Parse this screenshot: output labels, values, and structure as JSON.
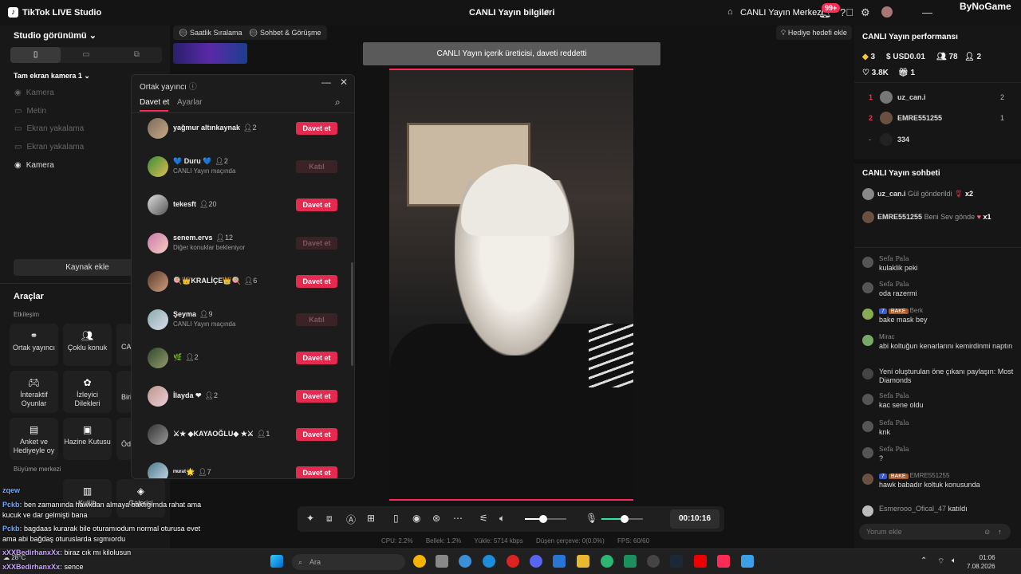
{
  "titlebar": {
    "app_title": "TikTok LIVE Studio",
    "center_title": "CANLI Yayın bilgileri",
    "live_center": "CANLI Yayın Merkezi",
    "notif_badge": "99+",
    "brand": "ByNoGame"
  },
  "left": {
    "studio_view": "Studio görünümü",
    "camera_scene": "Tam ekran kamera 1",
    "sources": [
      "Kamera",
      "Metin",
      "Ekran yakalama",
      "Ekran yakalama",
      "Kamera"
    ],
    "add_source": "Kaynak ekle",
    "tools_title": "Araçlar",
    "engagement": "Etkileşim",
    "tools": [
      {
        "label": "Ortak yayıncı",
        "icon": "link-icon"
      },
      {
        "label": "Çoklu konuk",
        "icon": "users-icon"
      },
      {
        "label": "CA",
        "icon": "more-icon"
      },
      {
        "label": "İnteraktif Oyunlar",
        "icon": "gamepad-icon"
      },
      {
        "label": "İzleyici Dilekleri",
        "icon": "gift-icon"
      },
      {
        "label": "Biri",
        "icon": "more-icon"
      },
      {
        "label": "Anket ve Hediyeyle oy",
        "icon": "poll-icon"
      },
      {
        "label": "Hazine Kutusu",
        "icon": "treasure-icon"
      },
      {
        "label": "Öd",
        "icon": "more-icon"
      }
    ],
    "growth": "Büyüme merkezi",
    "growth_tools": [
      "Kulüb",
      "Galerisi"
    ]
  },
  "chips": [
    "Saatlik Sıralama",
    "Sohbet & Görüşme"
  ],
  "gift_goal": "Hediye hedefi ekle",
  "toast": "CANLI Yayın içerik üreticisi, daveti reddetti",
  "dialog": {
    "title": "Ortak yayıncı",
    "tabs": [
      "Davet et",
      "Ayarlar"
    ],
    "rows": [
      {
        "name": "yağmur altınkaynak",
        "count": "2",
        "sub": "",
        "btn": "Davet et",
        "disabled": false
      },
      {
        "name": "💙 Duru 💙",
        "count": "2",
        "sub": "CANLI Yayın maçında",
        "btn": "Katıl",
        "disabled": true
      },
      {
        "name": "tekesft",
        "count": "20",
        "sub": "",
        "btn": "Davet et",
        "disabled": false
      },
      {
        "name": "senem.ervs",
        "count": "12",
        "sub": "Diğer konuklar bekleniyor",
        "btn": "Davet et",
        "disabled": true
      },
      {
        "name": "🍭👑KRALİÇE👑🍭",
        "count": "6",
        "sub": "",
        "btn": "Davet et",
        "disabled": false
      },
      {
        "name": "Şeyma",
        "count": "9",
        "sub": "CANLI Yayın maçında",
        "btn": "Katıl",
        "disabled": true
      },
      {
        "name": "🌿",
        "count": "2",
        "sub": "",
        "btn": "Davet et",
        "disabled": false
      },
      {
        "name": "İlayda ❤",
        "count": "2",
        "sub": "",
        "btn": "Davet et",
        "disabled": false
      },
      {
        "name": "⚔★ ◆KAYAOĞLU◆ ★⚔",
        "count": "1",
        "sub": "",
        "btn": "Davet et",
        "disabled": false
      },
      {
        "name": "ᵐᵘʳᵃᵗ🌟",
        "count": "7",
        "sub": "",
        "btn": "Davet et",
        "disabled": false
      }
    ]
  },
  "toolbar": {
    "timer": "00:10:16",
    "audio_level": 0.45,
    "mic_level": 0.55
  },
  "stats": {
    "cpu": "CPU: 2.2%",
    "memory": "Bellek: 1.2%",
    "upload": "Yükle: 5714 kbps",
    "dropped": "Düşen çerçeve: 0(0.0%)",
    "fps": "FPS: 60/60"
  },
  "right": {
    "perf_title": "CANLI Yayın performansı",
    "metrics": {
      "diamonds": "3",
      "usd": "USD0.01",
      "viewers": "78",
      "new_followers": "2",
      "likes": "3.8K",
      "gifters": "1"
    },
    "ranking": [
      {
        "rank": "1",
        "name": "uz_can.i",
        "value": "2"
      },
      {
        "rank": "2",
        "name": "EMRE551255",
        "value": "1"
      },
      {
        "rank": "-",
        "name": "334",
        "value": ""
      }
    ],
    "chat_title": "CANLI Yayın sohbeti",
    "gifts": [
      {
        "name": "uz_can.i",
        "text": "Gül gönderildi",
        "mult": "x2"
      },
      {
        "name": "EMRE551255",
        "text": "Beni Sev gönde",
        "mult": "x1"
      }
    ],
    "comments": [
      {
        "name": "Sefa Pala",
        "text": "kulaklik peki"
      },
      {
        "name": "Sefa Pala",
        "text": "oda razermi"
      },
      {
        "name": "Berk",
        "badge": "7",
        "badge2": "BAKE",
        "text": "bake mask bey"
      },
      {
        "name": "Mirac",
        "text": "abi koltuğun kenarlarını kemirdinmi naptın"
      },
      {
        "name": "",
        "text": "Yeni oluşturulan öne çıkanı paylaşın: Most Diamonds"
      },
      {
        "name": "Sefa Pala",
        "text": "kac sene oldu"
      },
      {
        "name": "Sefa Pala",
        "text": "knk"
      },
      {
        "name": "Sefa Pala",
        "text": "?"
      },
      {
        "name": "EMRE551255",
        "badge": "7",
        "badge2": "BAKE",
        "text": "hawk babadır koltuk konusunda"
      },
      {
        "name": "Esmerooo_Ofical_47",
        "text": "katıldı"
      }
    ],
    "comment_placeholder": "Yorum ekle"
  },
  "overlay_chat": [
    {
      "user": "zqew",
      "text": ""
    },
    {
      "user": "Pckb:",
      "text": "ben zamanında hawkdan almaya baktıgımda rahat ama"
    },
    {
      "user": "",
      "text": "kucuk ve dar gelmişti bana"
    },
    {
      "user": "Pckb:",
      "text": "bagdaas kurarak bile oturamıodum normal oturusa evet"
    },
    {
      "user": "",
      "text": "ama abi bağdaş oturuslarda sıgmıordu"
    },
    {
      "user": "xXXBedirhanxXx:",
      "text": "biraz cık mı kilolusun"
    },
    {
      "user": "xXXBedirhanxXx:",
      "text": "sence"
    }
  ],
  "taskbar": {
    "search": "Ara",
    "time": "01:06",
    "date": "7.08.2026",
    "weather": "28°C"
  }
}
